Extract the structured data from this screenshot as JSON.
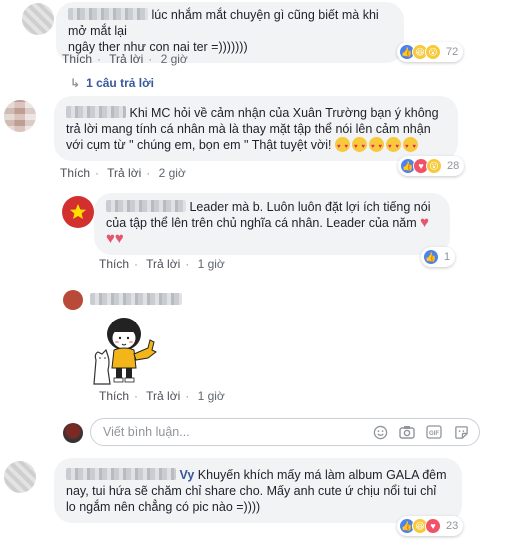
{
  "comments": [
    {
      "text_line1": "lúc nhắm mắt chuyện gì cũng biết mà khi mở mắt lại",
      "text_line2": "ngây ther như con nai ter =)))))))",
      "like": "Thích",
      "reply": "Trả lời",
      "time": "2 giờ",
      "reaction_count": "72",
      "replies_link": "1 câu trả lời"
    },
    {
      "text_line1": "Khi MC hỏi về cảm nhận của Xuân Trường bạn ý không",
      "text_line2": "trả lời mang tính cá nhân mà là thay mặt tập thể nói lên cảm nhận",
      "text_line3": "với cụm từ \" chúng em, bọn em \" Thật tuyệt vời!",
      "like": "Thích",
      "reply": "Trả lời",
      "time": "2 giờ",
      "reaction_count": "28"
    },
    {
      "text_line1": "Leader mà b. Luôn luôn đặt lợi ích tiếng nói",
      "text_line2": "của tập thể lên trên chủ nghĩa cá nhân. Leader của năm",
      "like": "Thích",
      "reply": "Trả lời",
      "time": "1 giờ",
      "reaction_count": "1"
    },
    {
      "like": "Thích",
      "reply": "Trả lời",
      "time": "1 giờ"
    },
    {
      "name_visible": "Vy",
      "text_line1": "Khuyến khích mấy má làm album GALA đêm",
      "text_line2": "nay, tui hứa sẽ chăm chỉ share cho. Mấy anh cute ứ chịu nổi tui chỉ",
      "text_line3": "lo ngắm nên chẳng có pic nào =))))",
      "reaction_count": "23"
    }
  ],
  "reply_input": {
    "placeholder": "Viết bình luận..."
  },
  "icons": {
    "emoji": "smiley-icon",
    "camera": "camera-icon",
    "gif": "gif-icon",
    "sticker": "sticker-icon",
    "like": "like-icon",
    "haha": "haha-icon",
    "wow": "wow-icon",
    "love": "love-icon",
    "reply_arrow": "reply-arrow-icon"
  },
  "colors": {
    "link": "#385898",
    "like": "#4a82f0",
    "bubble": "#f2f3f5"
  }
}
